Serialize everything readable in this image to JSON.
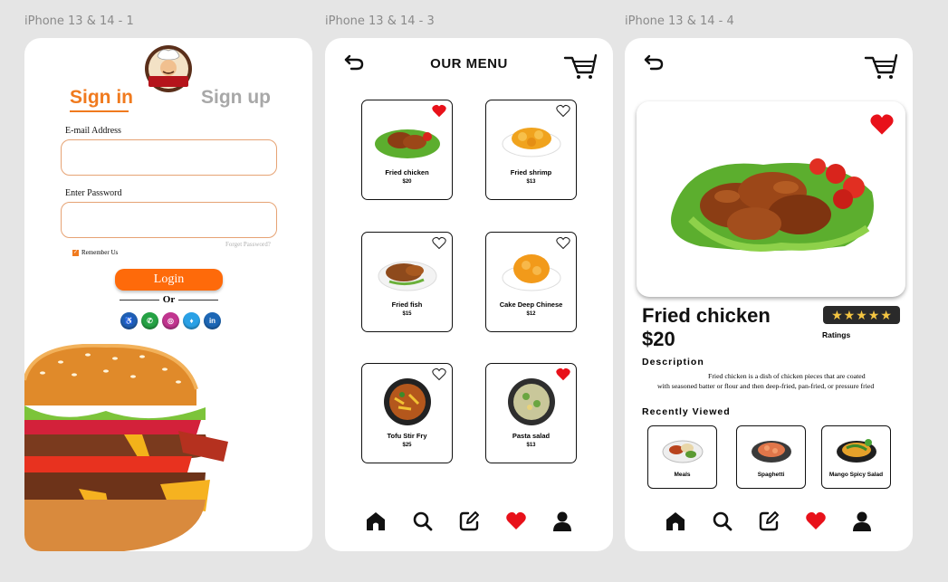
{
  "frames": [
    "iPhone 13 & 14 - 1",
    "iPhone 13 & 14 - 3",
    "iPhone 13 & 14 - 4"
  ],
  "login": {
    "tab_signin": "Sign in",
    "tab_signup": "Sign up",
    "email_label": "E-mail Address",
    "email_value": "",
    "password_label": "Enter Password",
    "password_value": "",
    "remember_label": "Remember Us",
    "remember_checked": true,
    "forget_label": "Forget Password?",
    "login_label": "Login",
    "or_label": "Or",
    "socials": [
      {
        "icon": "accessibility-icon",
        "glyph": "♿",
        "color": "#1f5fb3"
      },
      {
        "icon": "whatsapp-icon",
        "glyph": "✆",
        "color": "#25a244"
      },
      {
        "icon": "instagram-icon",
        "glyph": "◎",
        "color": "#c1358f"
      },
      {
        "icon": "twitter-icon",
        "glyph": "♦",
        "color": "#2aa1e6"
      },
      {
        "icon": "linkedin-icon",
        "glyph": "in",
        "color": "#1d67b5"
      }
    ],
    "accent": "#f07a1e"
  },
  "menu": {
    "title": "OUR MENU",
    "items": [
      {
        "name": "Fried chicken",
        "price": "$20",
        "favorite": true
      },
      {
        "name": "Fried shrimp",
        "price": "$13",
        "favorite": false
      },
      {
        "name": "Fried fish",
        "price": "$15",
        "favorite": false
      },
      {
        "name": "Cake Deep Chinese",
        "price": "$12",
        "favorite": false
      },
      {
        "name": "Tofu Stir Fry",
        "price": "$25",
        "favorite": false
      },
      {
        "name": "Pasta salad",
        "price": "$13",
        "favorite": true
      }
    ]
  },
  "detail": {
    "name": "Fried chicken",
    "price": "$20",
    "ratings_label": "Ratings",
    "rating_stars": 5,
    "description_heading": "Description",
    "description": "Fried chicken is a dish of chicken pieces that are coated with seasoned batter or flour and then deep-fried, pan-fried, or pressure fried",
    "recent_heading": "Recently Viewed",
    "recent": [
      {
        "name": "Meals"
      },
      {
        "name": "Spaghetti"
      },
      {
        "name": "Mango Spicy Salad"
      }
    ],
    "favorite": true
  },
  "nav": [
    "home-icon",
    "search-icon",
    "edit-icon",
    "favorites-icon",
    "profile-icon"
  ],
  "colors": {
    "heart": "#e8111a",
    "orange": "#fe6a0a"
  }
}
